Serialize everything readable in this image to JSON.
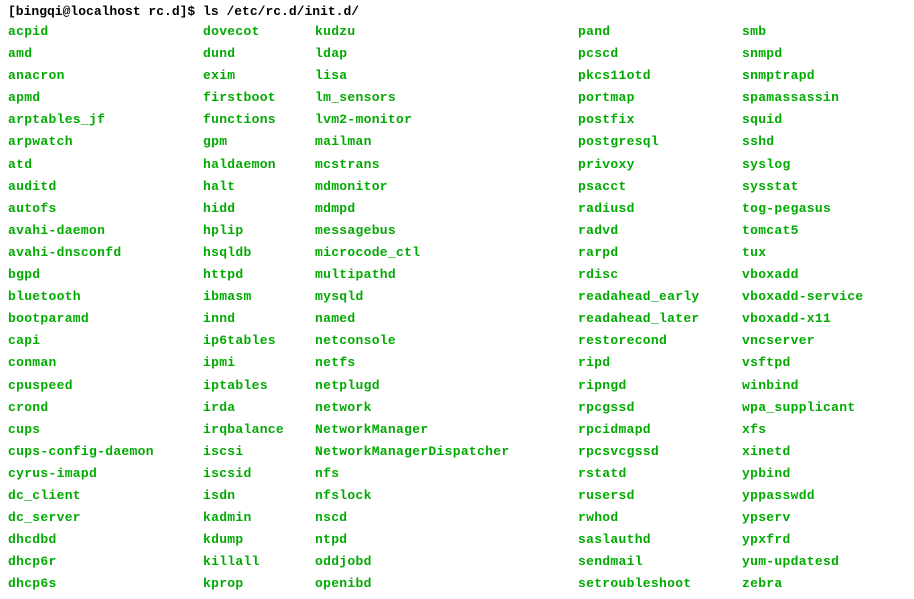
{
  "prompt": {
    "user_host_dir": "[bingqi@localhost rc.d]$ ",
    "command": "ls /etc/rc.d/init.d/"
  },
  "listing": {
    "col1": [
      "acpid",
      "amd",
      "anacron",
      "apmd",
      "arptables_jf",
      "arpwatch",
      "atd",
      "auditd",
      "autofs",
      "avahi-daemon",
      "avahi-dnsconfd",
      "bgpd",
      "bluetooth",
      "bootparamd",
      "capi",
      "conman",
      "cpuspeed",
      "crond",
      "cups",
      "cups-config-daemon",
      "cyrus-imapd",
      "dc_client",
      "dc_server",
      "dhcdbd",
      "dhcp6r",
      "dhcp6s"
    ],
    "col2": [
      "dovecot",
      "dund",
      "exim",
      "firstboot",
      "functions",
      "gpm",
      "haldaemon",
      "halt",
      "hidd",
      "hplip",
      "hsqldb",
      "httpd",
      "ibmasm",
      "innd",
      "ip6tables",
      "ipmi",
      "iptables",
      "irda",
      "irqbalance",
      "iscsi",
      "iscsid",
      "isdn",
      "kadmin",
      "kdump",
      "killall",
      "kprop"
    ],
    "col3": [
      "kudzu",
      "ldap",
      "lisa",
      "lm_sensors",
      "lvm2-monitor",
      "mailman",
      "mcstrans",
      "mdmonitor",
      "mdmpd",
      "messagebus",
      "microcode_ctl",
      "multipathd",
      "mysqld",
      "named",
      "netconsole",
      "netfs",
      "netplugd",
      "network",
      "NetworkManager",
      "NetworkManagerDispatcher",
      "nfs",
      "nfslock",
      "nscd",
      "ntpd",
      "oddjobd",
      "openibd"
    ],
    "col4": [
      "pand",
      "pcscd",
      "pkcs11otd",
      "portmap",
      "postfix",
      "postgresql",
      "privoxy",
      "psacct",
      "radiusd",
      "radvd",
      "rarpd",
      "rdisc",
      "readahead_early",
      "readahead_later",
      "restorecond",
      "ripd",
      "ripngd",
      "rpcgssd",
      "rpcidmapd",
      "rpcsvcgssd",
      "rstatd",
      "rusersd",
      "rwhod",
      "saslauthd",
      "sendmail",
      "setroubleshoot"
    ],
    "col5": [
      "smb",
      "snmpd",
      "snmptrapd",
      "spamassassin",
      "squid",
      "sshd",
      "syslog",
      "sysstat",
      "tog-pegasus",
      "tomcat5",
      "tux",
      "vboxadd",
      "vboxadd-service",
      "vboxadd-x11",
      "vncserver",
      "vsftpd",
      "winbind",
      "wpa_supplicant",
      "xfs",
      "xinetd",
      "ypbind",
      "yppasswdd",
      "ypserv",
      "ypxfrd",
      "yum-updatesd",
      "zebra"
    ]
  }
}
